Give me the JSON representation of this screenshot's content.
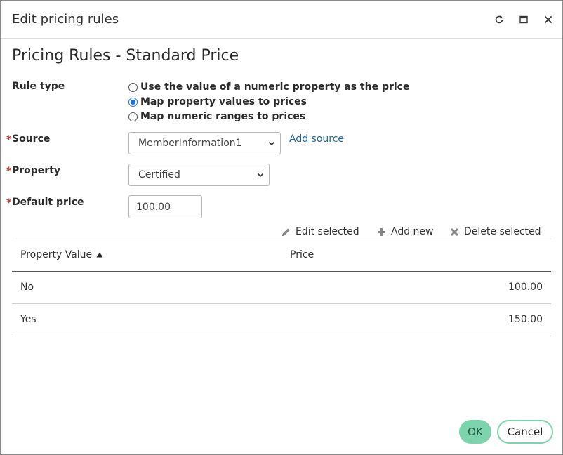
{
  "dialog": {
    "title": "Edit pricing rules",
    "icons": {
      "refresh": "refresh-icon",
      "maximize": "maximize-icon",
      "close": "close-icon"
    }
  },
  "section_title": "Pricing Rules - Standard Price",
  "rule_type": {
    "label": "Rule type",
    "options": [
      {
        "label": "Use the value of a numeric property as the price",
        "checked": false
      },
      {
        "label": "Map property values to prices",
        "checked": true
      },
      {
        "label": "Map numeric ranges to prices",
        "checked": false
      }
    ]
  },
  "source": {
    "required_mark": "*",
    "label": "Source",
    "value": "MemberInformation1",
    "add_link": "Add source"
  },
  "property": {
    "required_mark": "*",
    "label": "Property",
    "value": "Certified"
  },
  "default_price": {
    "required_mark": "*",
    "label": "Default price",
    "value": "100.00"
  },
  "actions": {
    "edit_selected": "Edit selected",
    "add_new": "Add new",
    "delete_selected": "Delete selected"
  },
  "table": {
    "columns": [
      "Property Value",
      "Price"
    ],
    "sort_column": "Property Value",
    "sort_direction": "ascending",
    "rows": [
      {
        "property_value": "No",
        "price": "100.00"
      },
      {
        "property_value": "Yes",
        "price": "150.00"
      }
    ]
  },
  "buttons": {
    "ok": "OK",
    "cancel": "Cancel"
  },
  "colors": {
    "primary_button": "#7dd3ab",
    "link": "#1f6aa0",
    "required": "#c0392b",
    "radio_checked": "#1a73e8"
  }
}
